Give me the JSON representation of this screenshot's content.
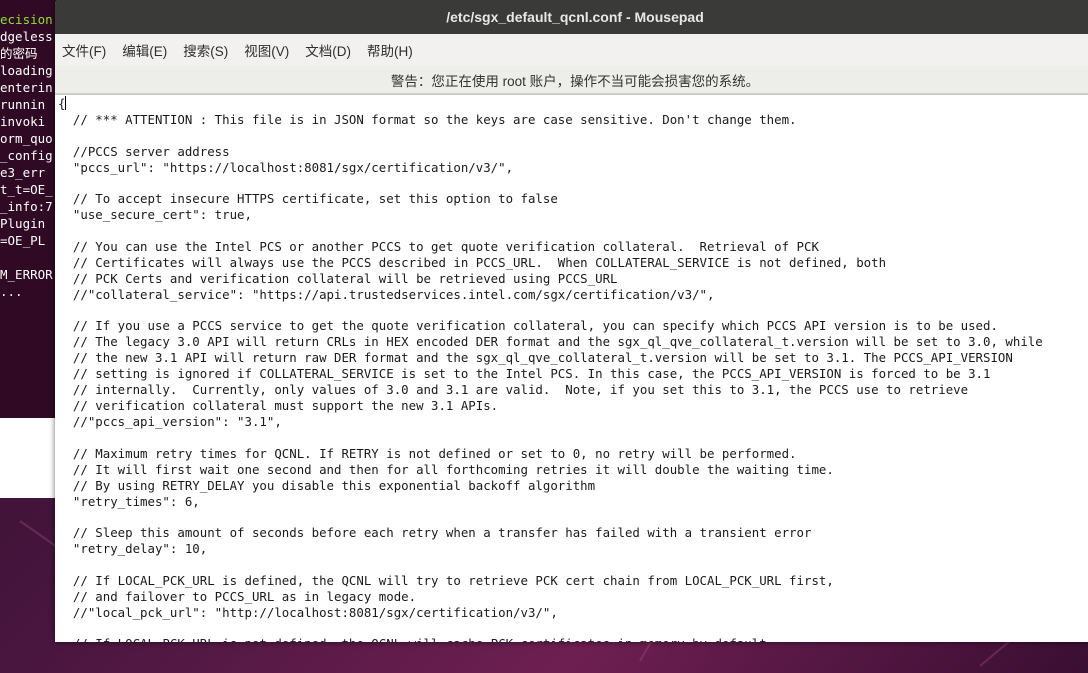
{
  "terminal": {
    "lines": [
      "ecision",
      "dgeless",
      "的密码",
      "loading",
      "enterin",
      "runnin",
      "invoki",
      "orm_quo",
      "_config",
      "e3_err",
      "t_t=OE_",
      "_info:7",
      "Plugin",
      "=OE_PL",
      "",
      "M_ERROR",
      "..."
    ]
  },
  "window": {
    "title": "/etc/sgx_default_qcnl.conf - Mousepad"
  },
  "menu": {
    "items": [
      "文件(F)",
      "编辑(E)",
      "搜索(S)",
      "视图(V)",
      "文档(D)",
      "帮助(H)"
    ]
  },
  "warning": {
    "text": "警告：您正在使用 root 账户，操作不当可能会损害您的系统。"
  },
  "editor": {
    "lines": [
      "{",
      "  // *** ATTENTION : This file is in JSON format so the keys are case sensitive. Don't change them.",
      "",
      "  //PCCS server address",
      "  \"pccs_url\": \"https://localhost:8081/sgx/certification/v3/\",",
      "",
      "  // To accept insecure HTTPS certificate, set this option to false",
      "  \"use_secure_cert\": true,",
      "",
      "  // You can use the Intel PCS or another PCCS to get quote verification collateral.  Retrieval of PCK",
      "  // Certificates will always use the PCCS described in PCCS_URL.  When COLLATERAL_SERVICE is not defined, both",
      "  // PCK Certs and verification collateral will be retrieved using PCCS_URL",
      "  //\"collateral_service\": \"https://api.trustedservices.intel.com/sgx/certification/v3/\",",
      "",
      "  // If you use a PCCS service to get the quote verification collateral, you can specify which PCCS API version is to be used.",
      "  // The legacy 3.0 API will return CRLs in HEX encoded DER format and the sgx_ql_qve_collateral_t.version will be set to 3.0, while",
      "  // the new 3.1 API will return raw DER format and the sgx_ql_qve_collateral_t.version will be set to 3.1. The PCCS_API_VERSION",
      "  // setting is ignored if COLLATERAL_SERVICE is set to the Intel PCS. In this case, the PCCS_API_VERSION is forced to be 3.1",
      "  // internally.  Currently, only values of 3.0 and 3.1 are valid.  Note, if you set this to 3.1, the PCCS use to retrieve",
      "  // verification collateral must support the new 3.1 APIs.",
      "  //\"pccs_api_version\": \"3.1\",",
      "",
      "  // Maximum retry times for QCNL. If RETRY is not defined or set to 0, no retry will be performed.",
      "  // It will first wait one second and then for all forthcoming retries it will double the waiting time.",
      "  // By using RETRY_DELAY you disable this exponential backoff algorithm",
      "  \"retry_times\": 6,",
      "",
      "  // Sleep this amount of seconds before each retry when a transfer has failed with a transient error",
      "  \"retry_delay\": 10,",
      "",
      "  // If LOCAL_PCK_URL is defined, the QCNL will try to retrieve PCK cert chain from LOCAL_PCK_URL first,",
      "  // and failover to PCCS_URL as in legacy mode.",
      "  //\"local_pck_url\": \"http://localhost:8081/sgx/certification/v3/\",",
      "",
      "  // If LOCAL_PCK_URL is not defined, the QCNL will cache PCK certificates in memory by default"
    ]
  }
}
